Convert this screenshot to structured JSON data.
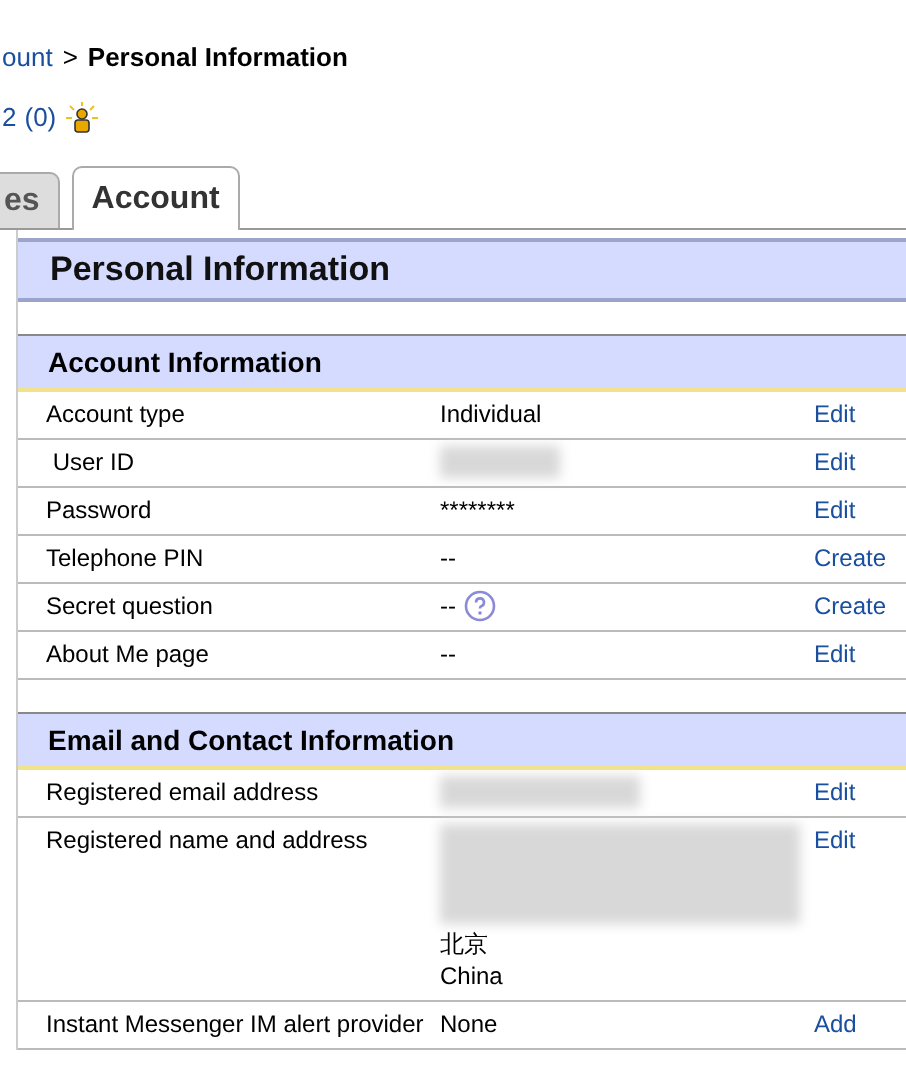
{
  "breadcrumb": {
    "link": "ount",
    "separator": ">",
    "current": "Personal Information"
  },
  "feedback": {
    "score": "2",
    "count": "(0)"
  },
  "tabs": [
    {
      "label": "es",
      "selected": false
    },
    {
      "label": "Account",
      "selected": true
    }
  ],
  "page_title": "Personal Information",
  "sections": [
    {
      "title": "Account Information",
      "rows": [
        {
          "label": "Account type",
          "value_lines": [
            "Individual"
          ],
          "redacted": false,
          "help": false,
          "action": "Edit"
        },
        {
          "label": " User ID",
          "value_lines": [],
          "redacted": true,
          "help": false,
          "action": "Edit"
        },
        {
          "label": "Password",
          "value_lines": [
            "********"
          ],
          "redacted": false,
          "help": false,
          "action": "Edit"
        },
        {
          "label": "Telephone PIN",
          "value_lines": [
            "--"
          ],
          "redacted": false,
          "help": false,
          "action": "Create"
        },
        {
          "label": "Secret question",
          "value_lines": [
            "--"
          ],
          "redacted": false,
          "help": true,
          "action": "Create"
        },
        {
          "label": "About Me page",
          "value_lines": [
            "--"
          ],
          "redacted": false,
          "help": false,
          "action": "Edit"
        }
      ]
    },
    {
      "title": "Email and Contact Information",
      "rows": [
        {
          "label": "Registered email address",
          "value_lines": [],
          "redacted": true,
          "help": false,
          "action": "Edit"
        },
        {
          "label": "Registered name and address",
          "value_lines": [
            "北京",
            "China"
          ],
          "redacted": true,
          "help": false,
          "action": "Edit"
        },
        {
          "label": "Instant Messenger IM alert provider",
          "value_lines": [
            "None"
          ],
          "redacted": false,
          "help": false,
          "action": "Add"
        }
      ]
    }
  ]
}
